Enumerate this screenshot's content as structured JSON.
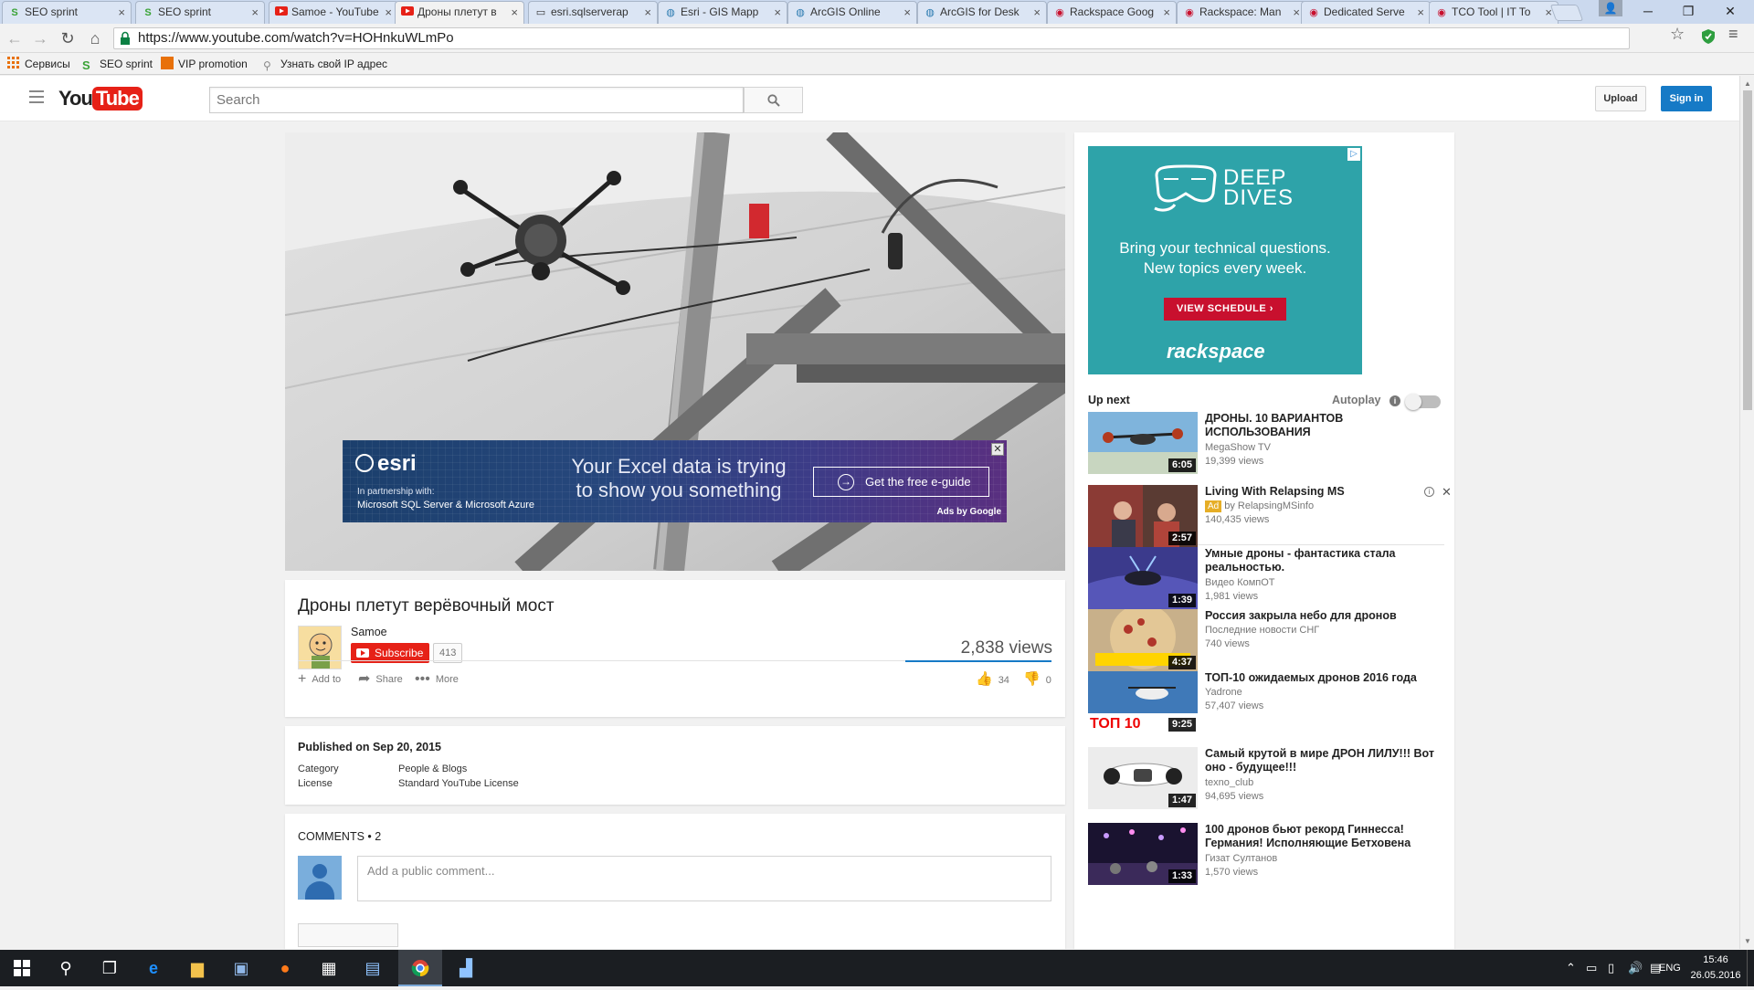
{
  "browser": {
    "tabs": [
      {
        "label": "SEO sprint",
        "favicon": "seo-sprint-favicon",
        "active": false
      },
      {
        "label": "SEO sprint",
        "favicon": "seo-sprint-favicon",
        "active": false
      },
      {
        "label": "Samoe - YouTube",
        "favicon": "youtube-favicon",
        "active": false
      },
      {
        "label": "Дроны плетут в",
        "favicon": "youtube-favicon",
        "active": true
      },
      {
        "label": "esri.sqlserverap",
        "favicon": "page-favicon",
        "active": false
      },
      {
        "label": "Esri - GIS Mapp",
        "favicon": "esri-favicon",
        "active": false
      },
      {
        "label": "ArcGIS Online",
        "favicon": "arcgis-favicon",
        "active": false
      },
      {
        "label": "ArcGIS for Desk",
        "favicon": "arcgis-favicon",
        "active": false
      },
      {
        "label": "Rackspace Goog",
        "favicon": "rackspace-favicon",
        "active": false
      },
      {
        "label": "Rackspace: Man",
        "favicon": "rackspace-favicon",
        "active": false
      },
      {
        "label": "Dedicated Serve",
        "favicon": "rackspace-favicon",
        "active": false
      },
      {
        "label": "TCO Tool | IT To",
        "favicon": "rackspace-favicon",
        "active": false
      }
    ],
    "url": "https://www.youtube.com/watch?v=HOHnkuWLmPo",
    "bookmarks": [
      {
        "label": "Сервисы",
        "icon": "apps-grid-icon"
      },
      {
        "label": "SEO sprint",
        "icon": "seo-sprint-icon"
      },
      {
        "label": "VIP promotion",
        "icon": "vip-promotion-icon"
      },
      {
        "label": "Узнать свой IP адрес",
        "icon": "search-icon"
      }
    ]
  },
  "youtube": {
    "search_placeholder": "Search",
    "upload_label": "Upload",
    "signin_label": "Sign in",
    "overlay_ad": {
      "brand": "esri",
      "partner_line1": "In partnership with:",
      "partner_line2": "Microsoft SQL Server & Microsoft Azure",
      "headline_line1": "Your Excel data is trying",
      "headline_line2": "to show you something",
      "cta": "Get the free e-guide",
      "attribution": "Ads by Google",
      "close": "✕"
    },
    "video": {
      "title": "Дроны плетут верёвочный мост",
      "channel": "Samoe",
      "subscribe_label": "Subscribe",
      "subscriber_count": "413",
      "views": "2,838 views",
      "likes": "34",
      "dislikes": "0",
      "sentiment_like_fraction": 1.0,
      "actions": {
        "add_to": "Add to",
        "share": "Share",
        "more": "More"
      }
    },
    "description": {
      "published": "Published on Sep 20, 2015",
      "category_label": "Category",
      "category_value": "People & Blogs",
      "license_label": "License",
      "license_value": "Standard YouTube License"
    },
    "comments": {
      "header": "COMMENTS • 2",
      "placeholder": "Add a public comment..."
    },
    "sidebar_ad": {
      "brand_line1": "DEEP",
      "brand_line2": "DIVES",
      "body_line1": "Bring your technical questions.",
      "body_line2": "New topics every week.",
      "cta": "VIEW SCHEDULE ›",
      "logo": "rackspace"
    },
    "up_next_label": "Up next",
    "autoplay_label": "Autoplay",
    "autoplay_on": false,
    "recommendations": [
      {
        "title": "ДРОНЫ. 10 ВАРИАНТОВ ИСПОЛЬЗОВАНИЯ",
        "channel": "MegaShow TV",
        "views": "19,399 views",
        "duration": "6:05",
        "ad": false
      },
      {
        "title": "Living With Relapsing MS",
        "channel": "by RelapsingMSinfo",
        "views": "140,435 views",
        "duration": "2:57",
        "ad": true,
        "ad_badge": "Ad"
      },
      {
        "title": "Умные дроны - фантастика стала реальностью.",
        "channel": "Видео КомпОТ",
        "views": "1,981 views",
        "duration": "1:39",
        "ad": false
      },
      {
        "title": "Россия закрыла небо для дронов",
        "channel": "Последние новости СНГ",
        "views": "740 views",
        "duration": "4:37",
        "ad": false
      },
      {
        "title": "ТОП-10 ожидаемых дронов 2016 года",
        "channel": "Yadrone",
        "views": "57,407 views",
        "duration": "9:25",
        "ad": false,
        "thumb_text": "ТОП 10"
      },
      {
        "title": "Самый крутой в мире ДРОН ЛИЛУ!!! Вот оно - будущее!!!",
        "channel": "texno_club",
        "views": "94,695 views",
        "duration": "1:47",
        "ad": false
      },
      {
        "title": "100 дронов бьют рекорд Гиннесса! Германия! Исполняющие Бетховена",
        "channel": "Гизат Султанов",
        "views": "1,570 views",
        "duration": "1:33",
        "ad": false
      }
    ]
  },
  "taskbar": {
    "language": "ENG",
    "time": "15:46",
    "date": "26.05.2016"
  }
}
